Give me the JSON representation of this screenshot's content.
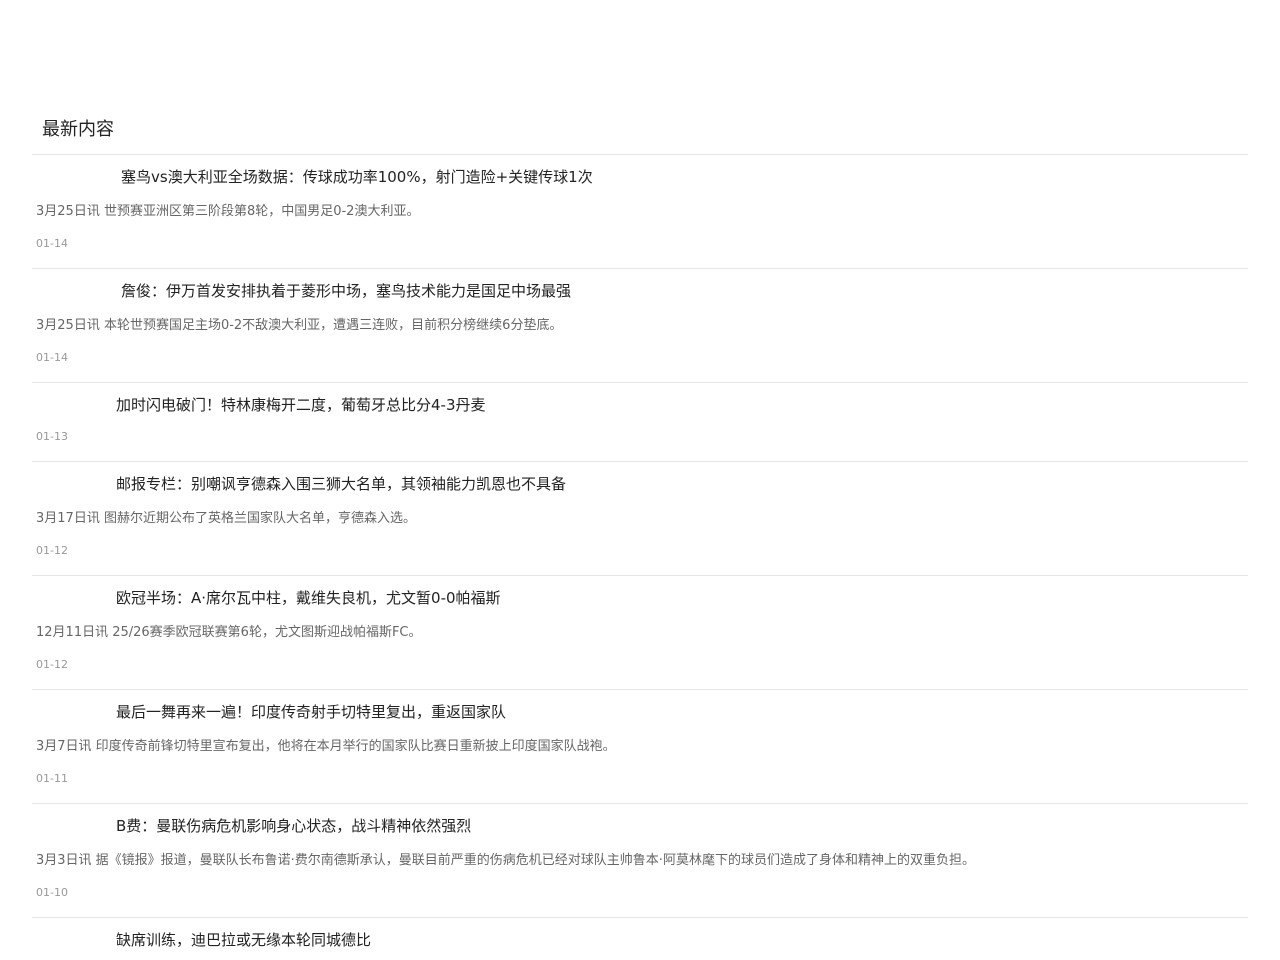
{
  "section": {
    "title": "最新内容"
  },
  "news": [
    {
      "title": "塞鸟vs澳大利亚全场数据：传球成功率100%，射门造险+关键传球1次",
      "summary": "3月25日讯 世预赛亚洲区第三阶段第8轮，中国男足0-2澳大利亚。",
      "date": "01-14"
    },
    {
      "title": "詹俊：伊万首发安排执着于菱形中场，塞鸟技术能力是国足中场最强",
      "summary": "3月25日讯  本轮世预赛国足主场0-2不敌澳大利亚，遭遇三连败，目前积分榜继续6分垫底。",
      "date": "01-14"
    },
    {
      "title": "加时闪电破门！特林康梅开二度，葡萄牙总比分4-3丹麦",
      "summary": "",
      "date": "01-13"
    },
    {
      "title": "邮报专栏：别嘲讽亨德森入围三狮大名单，其领袖能力凯恩也不具备",
      "summary": "3月17日讯 图赫尔近期公布了英格兰国家队大名单，亨德森入选。",
      "date": "01-12"
    },
    {
      "title": "欧冠半场：A·席尔瓦中柱，戴维失良机，尤文暂0-0帕福斯",
      "summary": "12月11日讯 25/26赛季欧冠联赛第6轮，尤文图斯迎战帕福斯FC。",
      "date": "01-12"
    },
    {
      "title": "最后一舞再来一遍！印度传奇射手切特里复出，重返国家队",
      "summary": "3月7日讯 印度传奇前锋切特里宣布复出，他将在本月举行的国家队比赛日重新披上印度国家队战袍。",
      "date": "01-11"
    },
    {
      "title": "B费：曼联伤病危机影响身心状态，战斗精神依然强烈",
      "summary": "3月3日讯 据《镜报》报道，曼联队长布鲁诺·费尔南德斯承认，曼联目前严重的伤病危机已经对球队主帅鲁本·阿莫林麾下的球员们造成了身体和精神上的双重负担。",
      "date": "01-10"
    },
    {
      "title": "缺席训练，迪巴拉或无缘本轮同城德比",
      "summary": "",
      "date": ""
    }
  ]
}
